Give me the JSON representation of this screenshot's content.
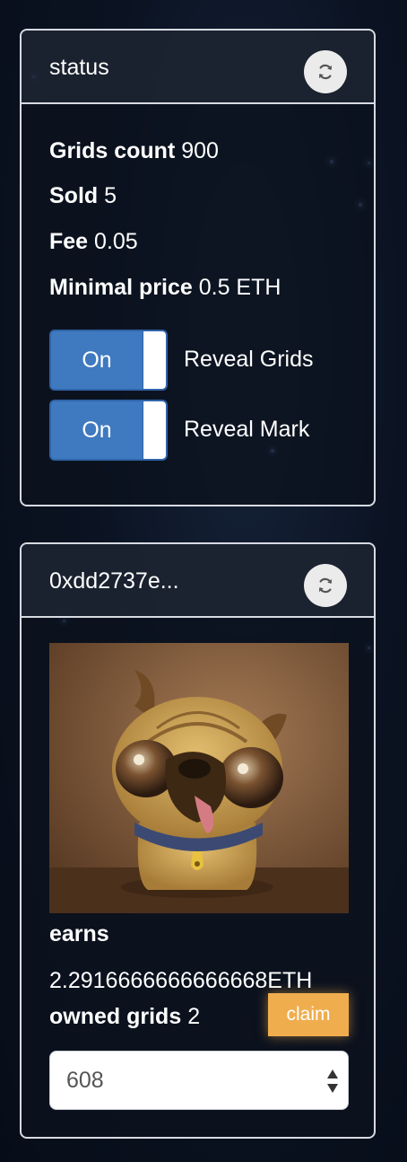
{
  "status_panel": {
    "title": "status",
    "grids_count_label": "Grids count",
    "grids_count_value": "900",
    "sold_label": "Sold",
    "sold_value": "5",
    "fee_label": "Fee",
    "fee_value": "0.05",
    "minimal_price_label": "Minimal price",
    "minimal_price_value": "0.5 ETH",
    "toggles": [
      {
        "state_label": "On",
        "label": "Reveal Grids"
      },
      {
        "state_label": "On",
        "label": "Reveal Mark"
      }
    ]
  },
  "account_panel": {
    "title": "0xdd2737e...",
    "earns_label": "earns",
    "earns_value": "2.2916666666666668ETH",
    "owned_grids_label": "owned grids",
    "owned_grids_value": "2",
    "claim_label": "claim",
    "selected_grid": "608"
  },
  "colors": {
    "toggle_on": "#3f7ac0",
    "claim": "#f0ad4e",
    "panel_border": "#d7dbe2"
  },
  "icons": {
    "refresh": "refresh-icon",
    "select_arrows": "updown-arrows-icon"
  }
}
